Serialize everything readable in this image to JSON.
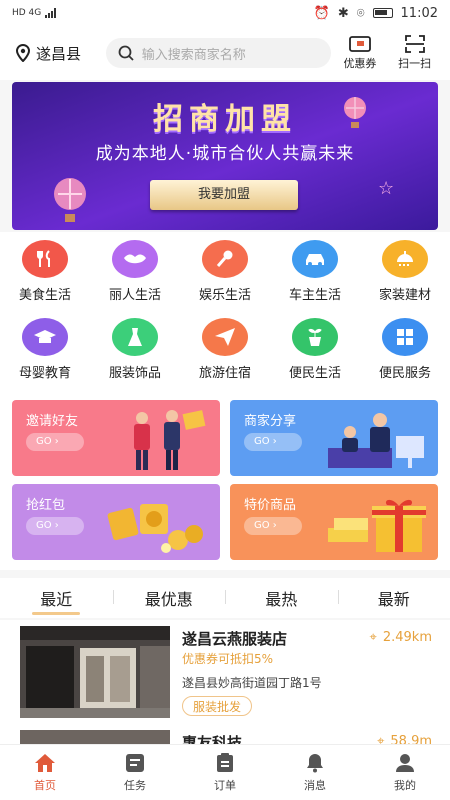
{
  "status": {
    "left": "HD 4G",
    "time": "11:02"
  },
  "header": {
    "location": "遂昌县",
    "search_placeholder": "输入搜索商家名称",
    "coupon_label": "优惠券",
    "scan_label": "扫一扫"
  },
  "banner": {
    "title": "招商加盟",
    "subtitle": "成为本地人·城市合伙人共赢未来",
    "button": "我要加盟"
  },
  "categories": [
    {
      "label": "美食生活",
      "icon": "fork-knife-icon",
      "color": "#f2574a"
    },
    {
      "label": "丽人生活",
      "icon": "lips-icon",
      "color": "#b46bf0"
    },
    {
      "label": "娱乐生活",
      "icon": "microphone-icon",
      "color": "#f56d4e"
    },
    {
      "label": "车主生活",
      "icon": "car-icon",
      "color": "#3f9bf0"
    },
    {
      "label": "家装建材",
      "icon": "lamp-icon",
      "color": "#f7b12a"
    },
    {
      "label": "母婴教育",
      "icon": "graduation-cap-icon",
      "color": "#8e5ee8"
    },
    {
      "label": "服装饰品",
      "icon": "dress-icon",
      "color": "#3ccf7a"
    },
    {
      "label": "旅游住宿",
      "icon": "paper-plane-icon",
      "color": "#f5784a"
    },
    {
      "label": "便民生活",
      "icon": "plant-icon",
      "color": "#34c46a"
    },
    {
      "label": "便民服务",
      "icon": "grid-icon",
      "color": "#3c8ff0"
    }
  ],
  "promos": [
    {
      "title": "邀请好友",
      "go": "GO ›",
      "color": "#f87a8a"
    },
    {
      "title": "商家分享",
      "go": "GO ›",
      "color": "#5d9df2"
    },
    {
      "title": "抢红包",
      "go": "GO ›",
      "color": "#c28be8"
    },
    {
      "title": "特价商品",
      "go": "GO ›",
      "color": "#f8925a"
    }
  ],
  "tabs": [
    "最近",
    "最优惠",
    "最热",
    "最新"
  ],
  "stores": [
    {
      "name": "遂昌云燕服装店",
      "distance": "2.49km",
      "coupon": "优惠券可抵扣5%",
      "address": "遂昌县妙高街道园丁路1号",
      "tag": "服装批发"
    },
    {
      "name": "惠友科技",
      "distance": "58.9m"
    }
  ],
  "nav": [
    {
      "label": "首页",
      "icon": "home-icon"
    },
    {
      "label": "任务",
      "icon": "task-icon"
    },
    {
      "label": "订单",
      "icon": "order-icon"
    },
    {
      "label": "消息",
      "icon": "bell-icon"
    },
    {
      "label": "我的",
      "icon": "user-icon"
    }
  ],
  "colors": {
    "accent": "#e05a3a",
    "gold": "#e6a13c",
    "banner": "#5a26c4"
  }
}
